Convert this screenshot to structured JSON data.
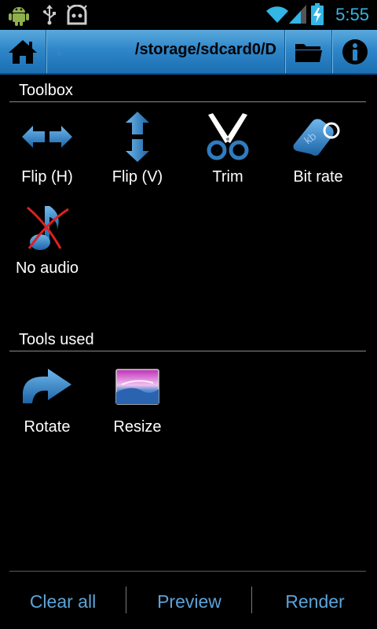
{
  "status_bar": {
    "time": "5:55",
    "icons": [
      "android-robot-icon",
      "usb-icon",
      "cyanogenmod-icon",
      "wifi-icon",
      "signal-icon",
      "battery-charging-icon"
    ]
  },
  "action_bar": {
    "home_icon": "home-icon",
    "path": "/storage/sdcard0/D",
    "folder_icon": "folder-icon",
    "info_icon": "info-icon"
  },
  "toolbox": {
    "title": "Toolbox",
    "items": [
      {
        "label": "Flip (H)",
        "icon": "flip-horizontal-icon"
      },
      {
        "label": "Flip (V)",
        "icon": "flip-vertical-icon"
      },
      {
        "label": "Trim",
        "icon": "scissors-icon"
      },
      {
        "label": "Bit rate",
        "icon": "bitrate-tag-icon"
      },
      {
        "label": "No audio",
        "icon": "no-audio-icon"
      }
    ]
  },
  "tools_used": {
    "title": "Tools used",
    "items": [
      {
        "label": "Rotate",
        "icon": "rotate-icon"
      },
      {
        "label": "Resize",
        "icon": "resize-image-icon"
      }
    ]
  },
  "bottom_bar": {
    "clear_all": "Clear all",
    "preview": "Preview",
    "render": "Render"
  },
  "colors": {
    "accent": "#33b5e5",
    "action_bar": "#2f86c8",
    "bottom_text": "#5ba3d8"
  }
}
